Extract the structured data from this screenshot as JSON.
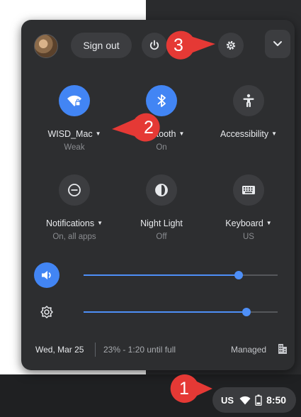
{
  "header": {
    "sign_out_label": "Sign out",
    "icons": [
      "avatar",
      "power-icon",
      "settings-icon",
      "chevron-down-icon"
    ]
  },
  "tiles": [
    {
      "label": "WISD_Mac",
      "sub": "Weak",
      "icon": "wifi-icon",
      "active": true
    },
    {
      "label": "Bluetooth",
      "sub": "On",
      "icon": "bluetooth-icon",
      "active": true
    },
    {
      "label": "Accessibility",
      "sub": "",
      "icon": "accessibility-icon",
      "active": false
    },
    {
      "label": "Notifications",
      "sub": "On, all apps",
      "icon": "notifications-icon",
      "active": false
    },
    {
      "label": "Night Light",
      "sub": "Off",
      "icon": "night-light-icon",
      "active": false
    },
    {
      "label": "Keyboard",
      "sub": "US",
      "icon": "keyboard-icon",
      "active": false
    }
  ],
  "sliders": {
    "volume_level": 0.8,
    "brightness_level": 0.84
  },
  "footer": {
    "date": "Wed, Mar 25",
    "battery": "23% - 1:20 until full",
    "managed": "Managed"
  },
  "shelf": {
    "input_method": "US",
    "time": "8:50"
  },
  "callouts": [
    "1",
    "2",
    "3"
  ],
  "colors": {
    "panel": "#2d2e30",
    "accent": "#4285f4",
    "callout": "#e53935"
  }
}
